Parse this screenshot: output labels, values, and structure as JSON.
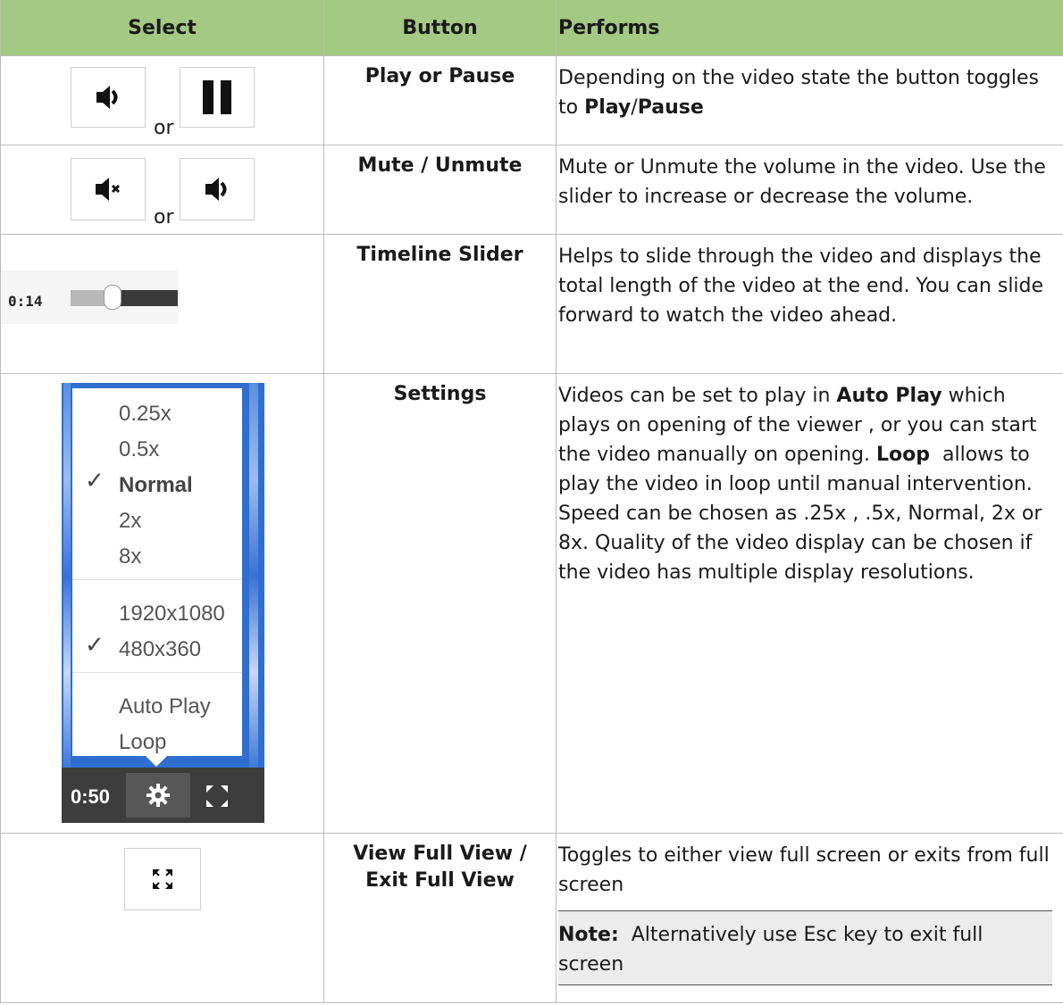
{
  "headers": {
    "select": "Select",
    "button": "Button",
    "performs": "Performs"
  },
  "rows": {
    "play": {
      "button": "Play or Pause",
      "or": "or",
      "text1": "Depending on the video state the button toggles to ",
      "bold_play": "Play",
      "slash": "/",
      "bold_pause": "Pause"
    },
    "mute": {
      "button": "Mute / Unmute",
      "or": "or",
      "text": "Mute or Unmute the volume in the video. Use the slider to increase or decrease the volume."
    },
    "timeline": {
      "button": "Timeline Slider",
      "time": "0:14",
      "progress": 0.5,
      "text": "Helps to slide through the video and displays the total length of the video at the end. You can slide forward to watch the video ahead."
    },
    "settings": {
      "button": "Settings",
      "menu": {
        "speeds": [
          "0.25x",
          "0.5x",
          "Normal",
          "2x",
          "8x"
        ],
        "selected_speed": "Normal",
        "resolutions": [
          "1920x1080",
          "480x360"
        ],
        "selected_resolution": "480x360",
        "options": [
          "Auto Play",
          "Loop"
        ]
      },
      "bar_time": "0:50",
      "text_a": "Videos can be set to play in ",
      "bold_autoplay": "Auto Play",
      "text_b": " which plays on opening of the viewer , or you can start the video manually on opening. ",
      "bold_loop": "Loop",
      "text_c": "  allows to play the video in loop until manual intervention. Speed can be chosen as .25x , .5x, Normal, 2x or 8x. Quality of the video display can be chosen if the video has multiple display resolutions."
    },
    "fullview": {
      "button_line1": "View Full View /",
      "button_line2": "Exit Full View",
      "text": "Toggles to either view full screen or exits from full screen",
      "note_label": "Note:",
      "note_text": "  Alternatively use Esc key to exit full screen"
    }
  },
  "icons": {
    "speaker": "speaker-icon",
    "pause": "pause-icon",
    "mute": "mute-icon",
    "gear": "gear-icon",
    "fullscreen": "fullscreen-icon",
    "check": "check-icon"
  },
  "colors": {
    "header_bg": "#a3c983",
    "grid": "#bdbdbd",
    "note_bg": "#ececec"
  }
}
